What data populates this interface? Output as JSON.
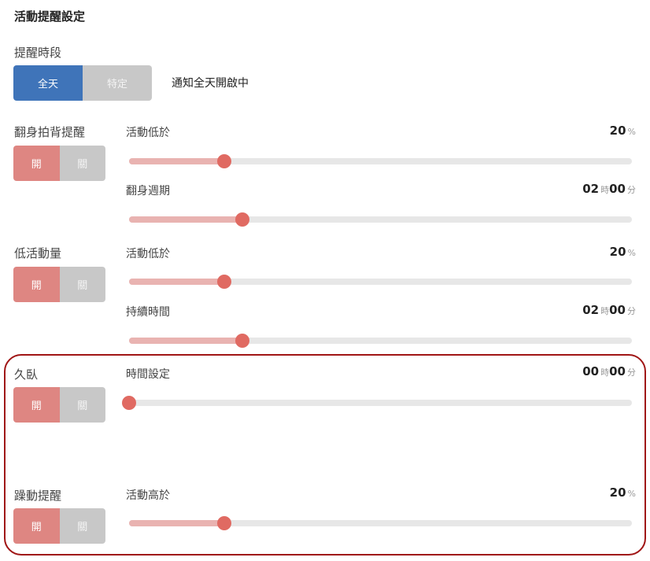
{
  "page_title": "活動提醒設定",
  "reminder_period": {
    "label": "提醒時段",
    "options": [
      "全天",
      "特定"
    ],
    "selected": "全天",
    "status_text": "通知全天開啟中"
  },
  "toggle_labels": {
    "on": "開",
    "off": "關"
  },
  "sections": [
    {
      "label": "翻身拍背提醒",
      "enabled": true,
      "params": [
        {
          "label": "活動低於",
          "value_parts": [
            "20",
            "%"
          ],
          "level": 0.19
        },
        {
          "label": "翻身週期",
          "value_parts": [
            "02",
            "時",
            "00",
            "分"
          ],
          "level": 0.225
        }
      ]
    },
    {
      "label": "低活動量",
      "enabled": true,
      "params": [
        {
          "label": "活動低於",
          "value_parts": [
            "20",
            "%"
          ],
          "level": 0.19
        },
        {
          "label": "持續時間",
          "value_parts": [
            "02",
            "時",
            "00",
            "分"
          ],
          "level": 0.225
        }
      ]
    },
    {
      "label": "久臥",
      "enabled": true,
      "params": [
        {
          "label": "時間設定",
          "value_parts": [
            "00",
            "時",
            "00",
            "分"
          ],
          "level": 0.0
        }
      ]
    },
    {
      "label": "躁動提醒",
      "enabled": true,
      "params": [
        {
          "label": "活動高於",
          "value_parts": [
            "20",
            "%"
          ],
          "level": 0.19
        }
      ]
    }
  ],
  "colors": {
    "selected_blue": "#3f74b9",
    "toggle_on": "#de8682",
    "toggle_off": "#c8c8c8",
    "slider_fill": "#e9b3b1",
    "slider_thumb": "#e06a62",
    "slider_track": "#e7e7e7",
    "highlight_border": "#a01515"
  }
}
